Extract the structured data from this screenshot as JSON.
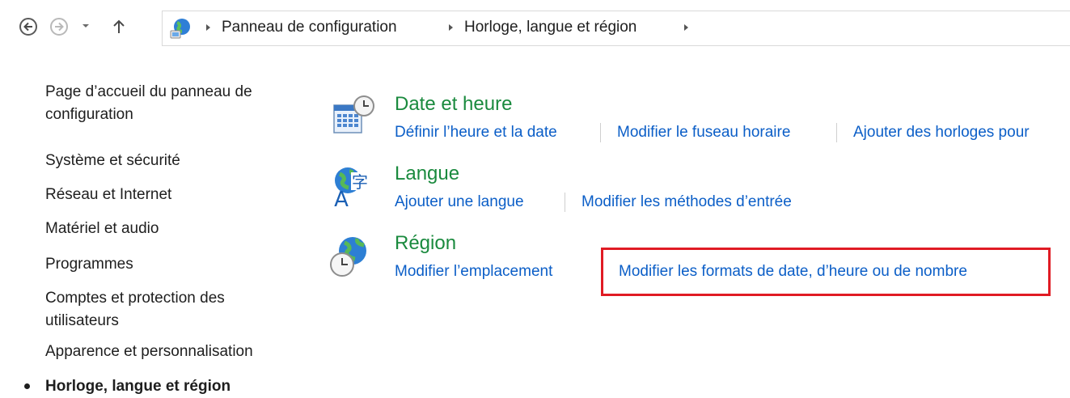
{
  "navigation": {
    "breadcrumbs": [
      "Panneau de configuration",
      "Horloge, langue et région"
    ]
  },
  "sidebar": {
    "links": [
      "Page d’accueil du panneau de configuration",
      "Système et sécurité",
      "Réseau et Internet",
      "Matériel et audio",
      "Programmes",
      "Comptes et protection des utilisateurs",
      "Apparence et personnalisation"
    ],
    "current": "Horloge, langue et région"
  },
  "categories": [
    {
      "title": "Date et heure",
      "icon": "calendar-clock-icon",
      "tasks": [
        "Définir l’heure et la date",
        "Modifier le fuseau horaire",
        "Ajouter des horloges pour"
      ]
    },
    {
      "title": "Langue",
      "icon": "language-globe-icon",
      "tasks": [
        "Ajouter une langue",
        "Modifier les méthodes d’entrée"
      ]
    },
    {
      "title": "Région",
      "icon": "region-globe-clock-icon",
      "tasks": [
        "Modifier l’emplacement",
        "Modifier les formats de date, d’heure ou de nombre"
      ]
    }
  ],
  "colors": {
    "category_title": "#1a8a3e",
    "task_link": "#0b5ec7",
    "highlight_box": "#e01b24"
  }
}
